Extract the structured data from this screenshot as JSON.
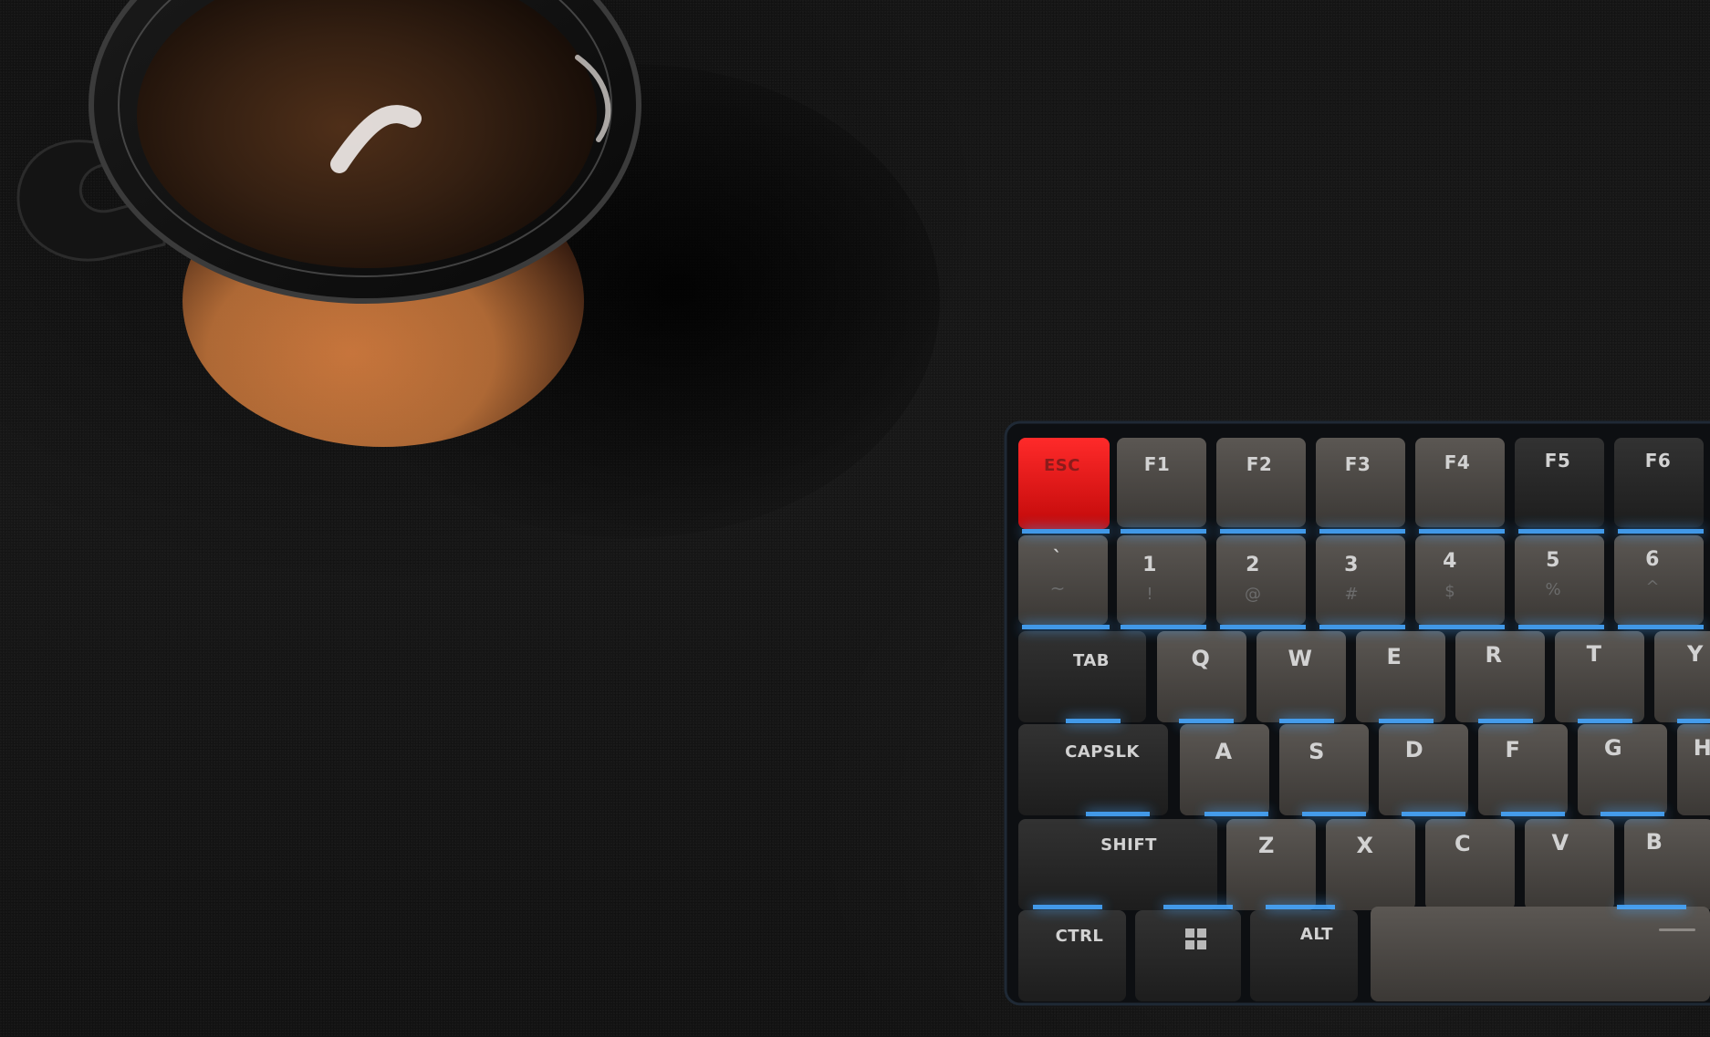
{
  "colors": {
    "desk": "#141414",
    "key_dark": "#262626",
    "key_grey": "#4a4744",
    "key_red": "#ff1010",
    "backlight_blue": "#46a7ff",
    "coaster": "#b66d37",
    "coffee": "#3b2414"
  },
  "objects": {
    "mug": "coffee-mug",
    "coaster": "cork-coaster",
    "keyboard": "mechanical-keyboard"
  },
  "keyboard": {
    "row0": [
      "ESC",
      "F1",
      "F2",
      "F3",
      "F4",
      "F5",
      "F6"
    ],
    "row1": [
      "`",
      "1",
      "2",
      "3",
      "4",
      "5",
      "6"
    ],
    "row1_sub": [
      "~",
      "!",
      "@",
      "#",
      "$",
      "%",
      "^"
    ],
    "row2_mod": "TAB",
    "row2": [
      "Q",
      "W",
      "E",
      "R",
      "T",
      "Y"
    ],
    "row3_mod": "CAPSLK",
    "row3": [
      "A",
      "S",
      "D",
      "F",
      "G",
      "H"
    ],
    "row4_mod": "SHIFT",
    "row4": [
      "Z",
      "X",
      "C",
      "V",
      "B"
    ],
    "row5_mod_1": "CTRL",
    "row5_mod_2": "ALT"
  }
}
